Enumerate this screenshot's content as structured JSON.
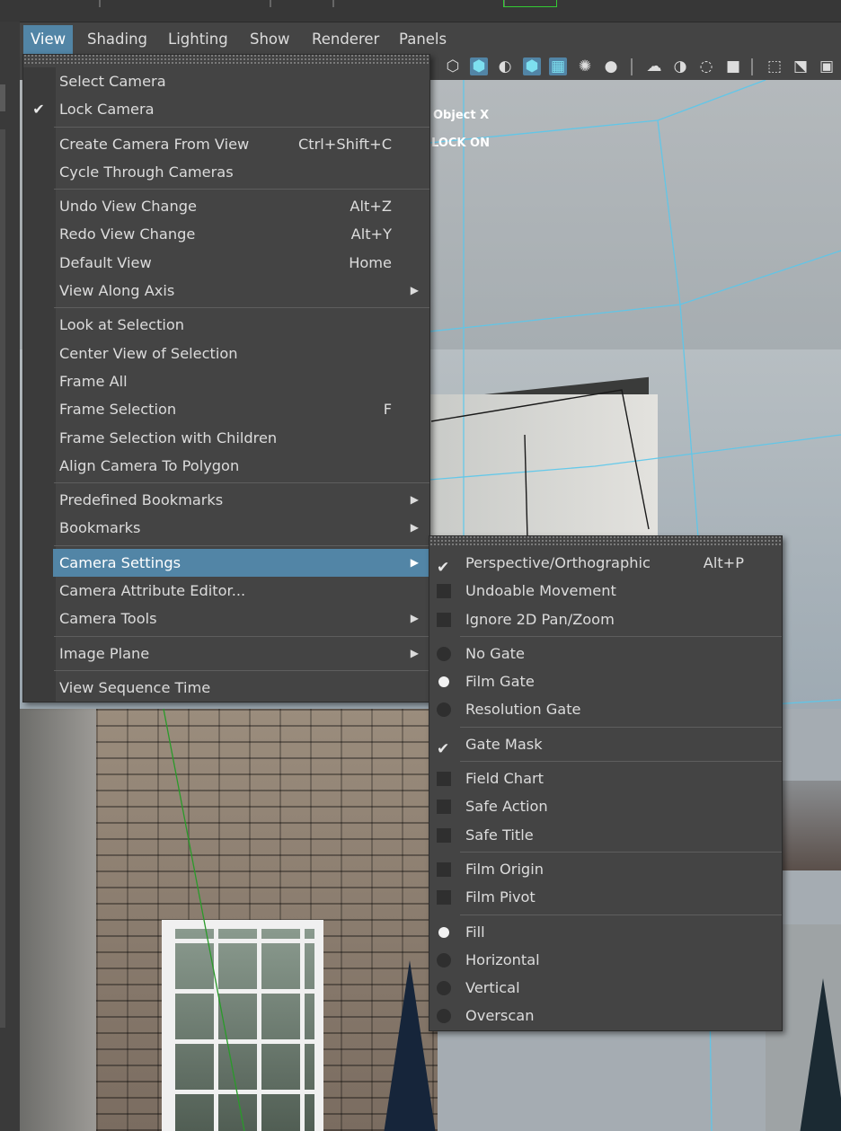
{
  "menubar": {
    "items": [
      "View",
      "Shading",
      "Lighting",
      "Show",
      "Renderer",
      "Panels"
    ],
    "active": "View"
  },
  "hud": {
    "line1": "Object X",
    "line2": "LOCK ON"
  },
  "view_menu": {
    "groups": [
      [
        {
          "label": "Select Camera"
        },
        {
          "label": "Lock Camera",
          "checked": true
        }
      ],
      [
        {
          "label": "Create Camera From View",
          "shortcut": "Ctrl+Shift+C"
        },
        {
          "label": "Cycle Through Cameras"
        }
      ],
      [
        {
          "label": "Undo View Change",
          "shortcut": "Alt+Z"
        },
        {
          "label": "Redo View Change",
          "shortcut": "Alt+Y"
        },
        {
          "label": "Default View",
          "shortcut": "Home"
        },
        {
          "label": "View Along Axis",
          "submenu": true
        }
      ],
      [
        {
          "label": "Look at Selection"
        },
        {
          "label": "Center View of Selection"
        },
        {
          "label": "Frame All"
        },
        {
          "label": "Frame Selection",
          "shortcut": "F"
        },
        {
          "label": "Frame Selection with Children"
        },
        {
          "label": "Align Camera To Polygon"
        }
      ],
      [
        {
          "label": "Predefined Bookmarks",
          "submenu": true
        },
        {
          "label": "Bookmarks",
          "submenu": true
        }
      ],
      [
        {
          "label": "Camera Settings",
          "submenu": true,
          "highlighted": true
        },
        {
          "label": "Camera Attribute Editor..."
        },
        {
          "label": "Camera Tools",
          "submenu": true
        }
      ],
      [
        {
          "label": "Image Plane",
          "submenu": true
        }
      ],
      [
        {
          "label": "View Sequence Time"
        }
      ]
    ]
  },
  "camera_settings_menu": {
    "groups": [
      [
        {
          "label": "Perspective/Orthographic",
          "shortcut": "Alt+P",
          "type": "check",
          "on": true
        },
        {
          "label": "Undoable Movement",
          "type": "check",
          "on": false
        },
        {
          "label": "Ignore 2D Pan/Zoom",
          "type": "check",
          "on": false
        }
      ],
      [
        {
          "label": "No Gate",
          "type": "radio",
          "on": false
        },
        {
          "label": "Film Gate",
          "type": "radio",
          "on": true
        },
        {
          "label": "Resolution Gate",
          "type": "radio",
          "on": false
        }
      ],
      [
        {
          "label": "Gate Mask",
          "type": "check",
          "on": true
        }
      ],
      [
        {
          "label": "Field Chart",
          "type": "check",
          "on": false
        },
        {
          "label": "Safe Action",
          "type": "check",
          "on": false
        },
        {
          "label": "Safe Title",
          "type": "check",
          "on": false
        }
      ],
      [
        {
          "label": "Film Origin",
          "type": "check",
          "on": false
        },
        {
          "label": "Film Pivot",
          "type": "check",
          "on": false
        }
      ],
      [
        {
          "label": "Fill",
          "type": "radio",
          "on": true
        },
        {
          "label": "Horizontal",
          "type": "radio",
          "on": false
        },
        {
          "label": "Vertical",
          "type": "radio",
          "on": false
        },
        {
          "label": "Overscan",
          "type": "radio",
          "on": false
        }
      ]
    ]
  }
}
